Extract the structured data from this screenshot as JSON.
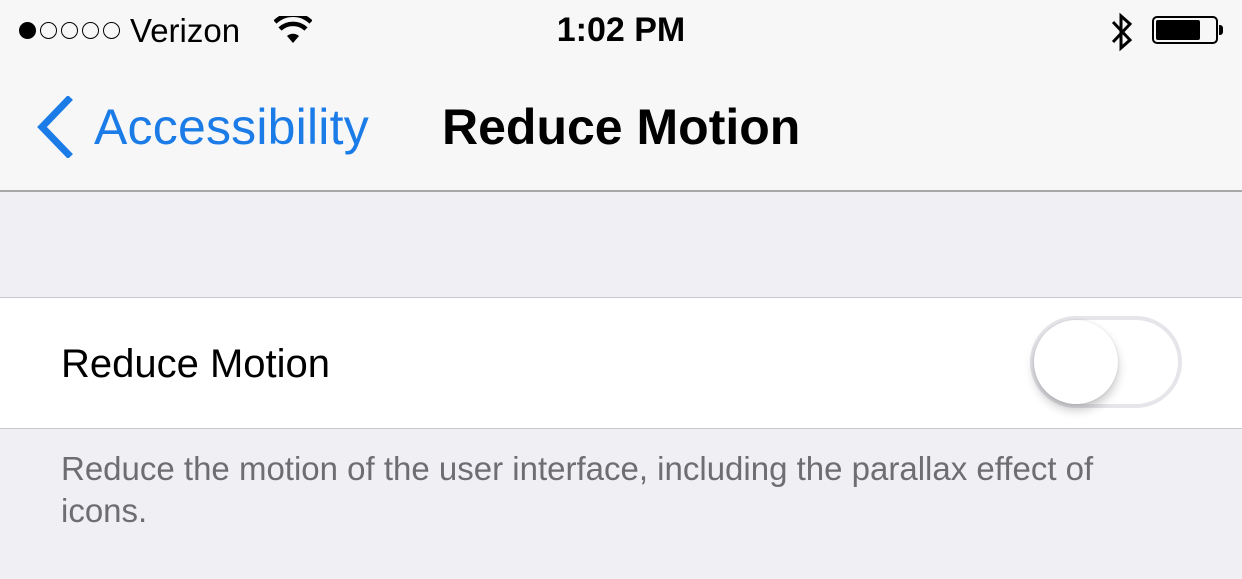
{
  "status_bar": {
    "signal_bars_total": 5,
    "signal_bars_filled": 1,
    "carrier": "Verizon",
    "wifi_icon": "wifi-icon",
    "time": "1:02 PM",
    "bluetooth_icon": "bluetooth-icon",
    "battery_level_percent": 75
  },
  "nav": {
    "back_label": "Accessibility",
    "title": "Reduce Motion",
    "accent_color": "#1b7ce8"
  },
  "settings": {
    "rows": [
      {
        "label": "Reduce Motion",
        "toggle_on": false
      }
    ],
    "footer": "Reduce the motion of the user interface, including the parallax effect of icons."
  }
}
